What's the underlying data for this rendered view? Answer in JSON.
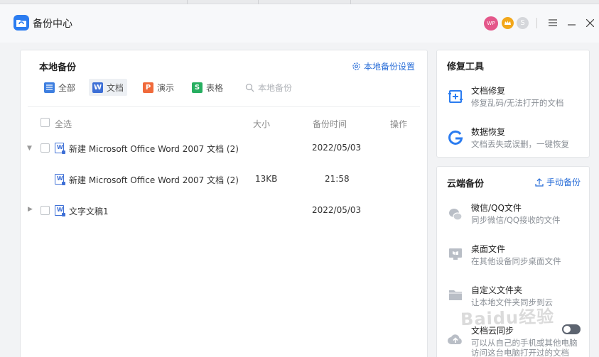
{
  "app": {
    "title": "备份中心",
    "avatar_text": "WP",
    "coin_text": "S"
  },
  "colors": {
    "accent": "#2b6fd8",
    "word": "#3d6fd6",
    "all": "#3e7fe0",
    "ppt": "#f06a3b",
    "sheet": "#27ae60"
  },
  "local": {
    "title": "本地备份",
    "settings_label": "本地备份设置",
    "tabs": [
      {
        "label": "全部",
        "icon": "list-icon"
      },
      {
        "label": "文档",
        "icon": "W"
      },
      {
        "label": "演示",
        "icon": "P"
      },
      {
        "label": "表格",
        "icon": "S"
      }
    ],
    "search_placeholder": "本地备份",
    "columns": {
      "select_all": "全选",
      "size": "大小",
      "time": "备份时间",
      "action": "操作"
    },
    "rows": [
      {
        "name": "新建 Microsoft Office Word 2007 文档 (2)",
        "size": "",
        "time": "2022/05/03",
        "expanded": true
      },
      {
        "name": "新建 Microsoft Office Word 2007 文档 (2)",
        "size": "13KB",
        "time": "21:58",
        "child": true
      },
      {
        "name": "文字文稿1",
        "size": "",
        "time": "2022/05/03",
        "expanded": false
      }
    ]
  },
  "repair": {
    "title": "修复工具",
    "items": [
      {
        "name": "文档修复",
        "desc": "修复乱码/无法打开的文档",
        "icon": "doc-repair-icon"
      },
      {
        "name": "数据恢复",
        "desc": "文档丢失或误删，一键恢复",
        "icon": "data-recovery-icon"
      }
    ]
  },
  "cloud": {
    "title": "云端备份",
    "manual_label": "手动备份",
    "items": [
      {
        "name": "微信/QQ文件",
        "desc": "同步微信/QQ接收的文件",
        "icon": "wechat-qq-icon"
      },
      {
        "name": "桌面文件",
        "desc": "在其他设备同步桌面文件",
        "icon": "desktop-icon"
      },
      {
        "name": "自定义文件夹",
        "desc": "让本地文件夹同步到云",
        "icon": "folder-icon"
      },
      {
        "name": "文档云同步",
        "desc": "可以从自己的手机或其他电脑",
        "desc2": "访问这台电脑打开过的文档",
        "icon": "cloud-upload-icon",
        "toggle_on": true
      }
    ]
  },
  "watermark": "Baidu经验"
}
